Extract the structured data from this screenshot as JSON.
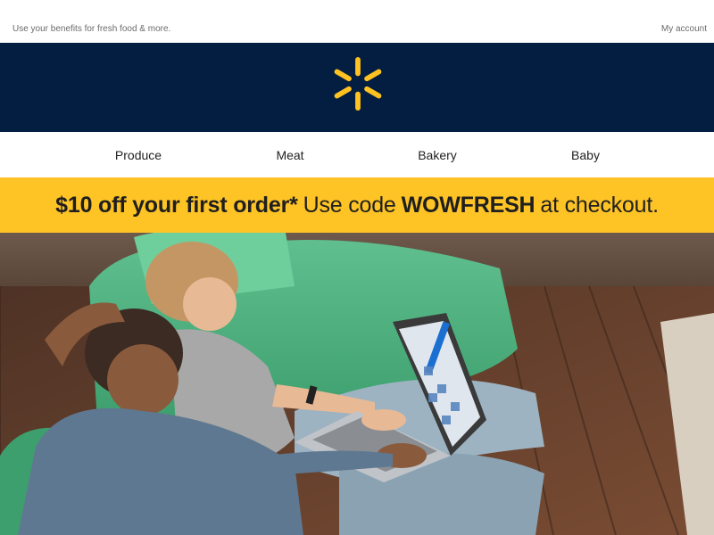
{
  "topbar": {
    "tagline": "Use your benefits for fresh food & more.",
    "account_link": "My account"
  },
  "header": {
    "logo_icon": "walmart-spark-icon",
    "spark_color": "#ffc220",
    "background_color": "#041e42"
  },
  "categories": [
    {
      "label": "Produce"
    },
    {
      "label": "Meat"
    },
    {
      "label": "Bakery"
    },
    {
      "label": "Baby"
    }
  ],
  "promo": {
    "part1": "$10 off your first order*",
    "part2": "Use code",
    "code": "WOWFRESH",
    "part3": "at checkout.",
    "background_color": "#fec325"
  },
  "hero": {
    "image": "couple-on-sofa-with-laptop"
  }
}
